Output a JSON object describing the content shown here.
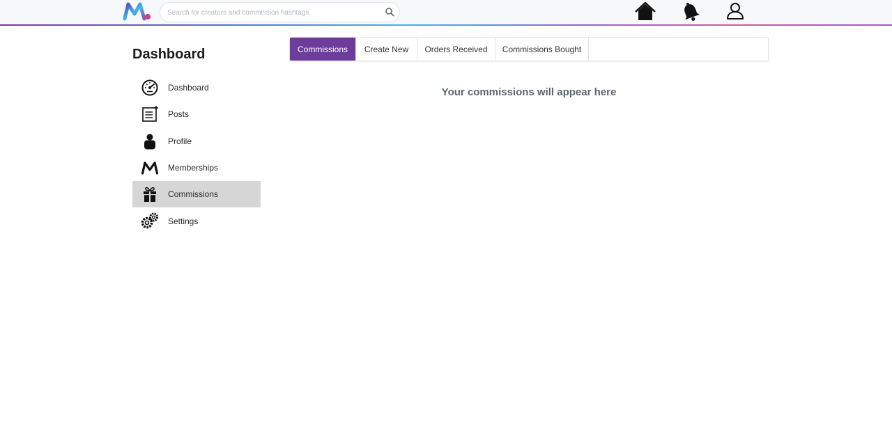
{
  "header": {
    "search_placeholder": "Search for creators and commission hashtags",
    "icons": [
      "logo",
      "search-icon",
      "home-icon",
      "bell-icon",
      "user-icon"
    ],
    "accent_gradient": [
      "#7a3a9e",
      "#3fb6e8",
      "#d8579a"
    ]
  },
  "sidebar": {
    "title": "Dashboard",
    "active_index": 4,
    "items": [
      {
        "label": "Dashboard",
        "icon": "speedometer-icon"
      },
      {
        "label": "Posts",
        "icon": "posts-icon"
      },
      {
        "label": "Profile",
        "icon": "person-icon"
      },
      {
        "label": "Memberships",
        "icon": "m-logo-icon"
      },
      {
        "label": "Commissions",
        "icon": "gift-icon"
      },
      {
        "label": "Settings",
        "icon": "gears-icon"
      }
    ],
    "active_bg": "#d6d6d6"
  },
  "main": {
    "tabs": [
      {
        "label": "Commissions"
      },
      {
        "label": "Create New"
      },
      {
        "label": "Orders Received"
      },
      {
        "label": "Commissions Bought"
      }
    ],
    "active_tab_color": "#6e3c9d",
    "empty_message": "Your commissions will appear here"
  }
}
